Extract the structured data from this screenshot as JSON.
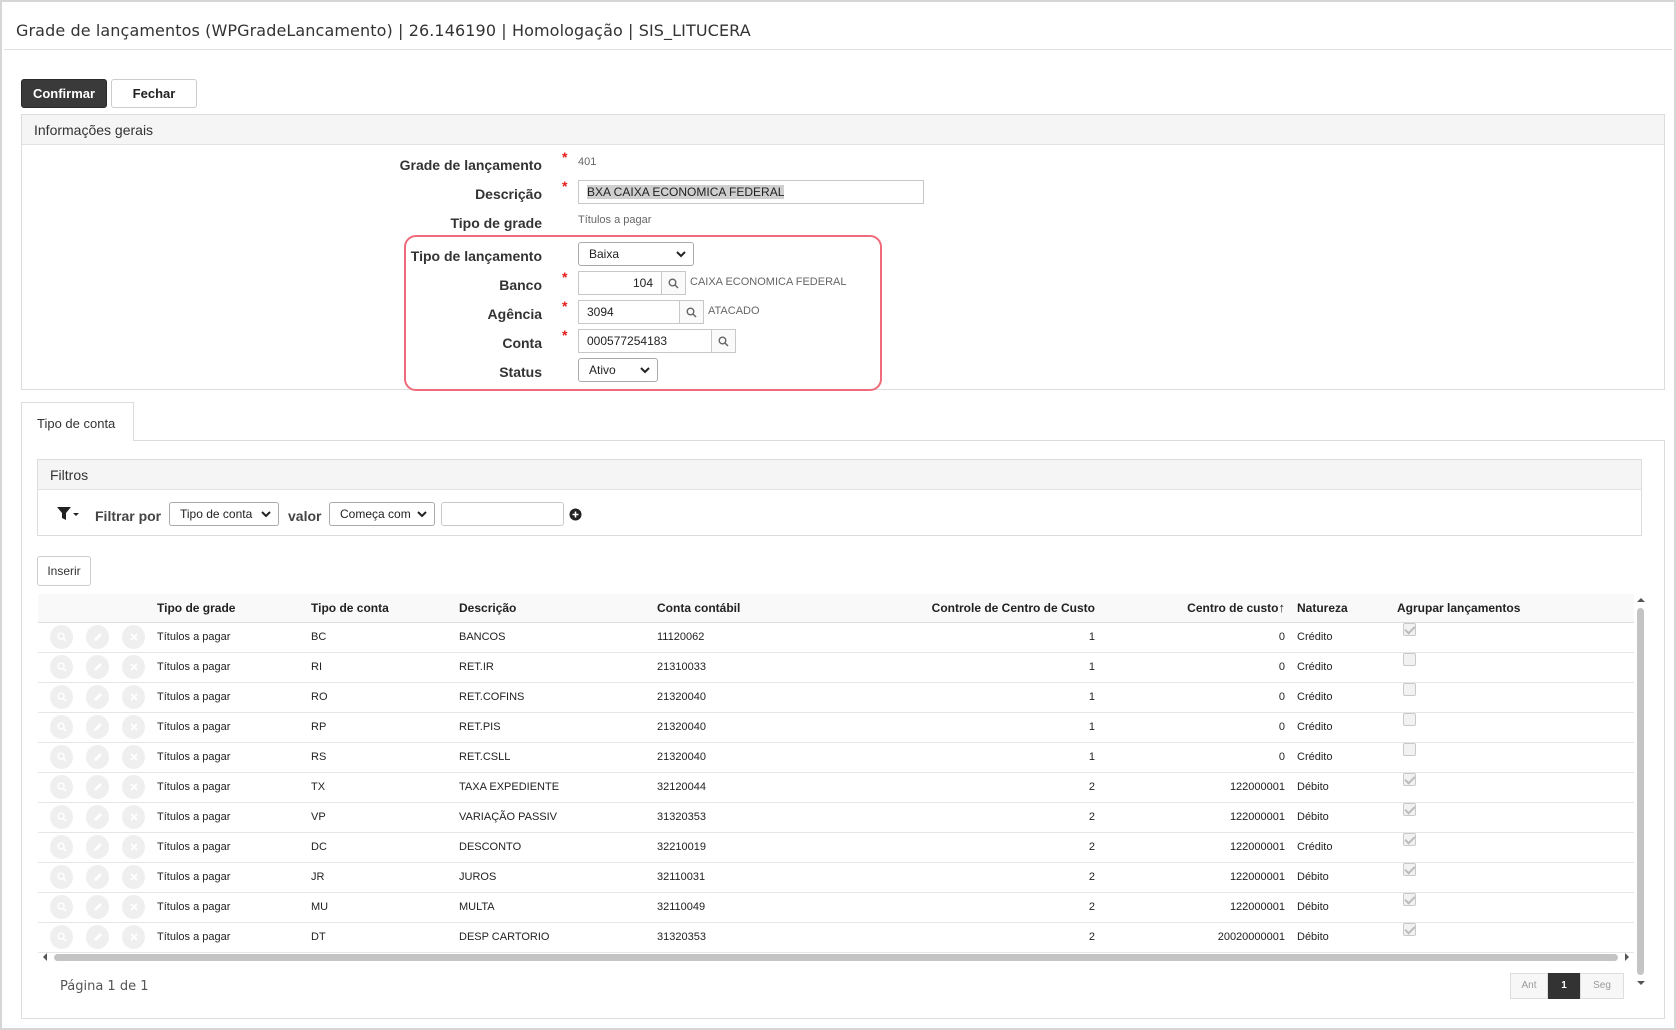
{
  "window": {
    "title": "Grade de lançamentos (WPGradeLancamento) | 26.146190 | Homologação | SIS_LITUCERA"
  },
  "toolbar": {
    "confirm_label": "Confirmar",
    "close_label": "Fechar"
  },
  "general": {
    "header": "Informações gerais",
    "fields": {
      "grade_label": "Grade de lançamento",
      "grade_value": "401",
      "descricao_label": "Descrição",
      "descricao_value": "BXA CAIXA ECONOMICA FEDERAL",
      "tipo_grade_label": "Tipo de grade",
      "tipo_grade_value": "Títulos a pagar",
      "tipo_lanc_label": "Tipo de lançamento",
      "tipo_lanc_value": "Baixa",
      "banco_label": "Banco",
      "banco_value": "104",
      "banco_desc": "CAIXA ECONOMICA FEDERAL",
      "agencia_label": "Agência",
      "agencia_value": "3094",
      "agencia_desc": "ATACADO",
      "conta_label": "Conta",
      "conta_value": "000577254183",
      "status_label": "Status",
      "status_value": "Ativo"
    },
    "required_mark": "*"
  },
  "tabs": [
    {
      "label": "Tipo de conta"
    }
  ],
  "filters": {
    "header": "Filtros",
    "filter_by_label": "Filtrar por",
    "filter_field_value": "Tipo de conta",
    "value_label": "valor",
    "operator_value": "Começa com",
    "input_value": ""
  },
  "insert_label": "Inserir",
  "table": {
    "columns": [
      "",
      "Tipo de grade",
      "Tipo de conta",
      "Descrição",
      "Conta contábil",
      "Controle de Centro de Custo",
      "Centro de custo",
      "Natureza",
      "Agrupar lançamentos"
    ],
    "sort_indicator": "↑",
    "rows": [
      {
        "tipo_grade": "Títulos a pagar",
        "tipo_conta": "BC",
        "descricao": "BANCOS",
        "conta_contabil": "11120062",
        "controle_cc": "1",
        "centro_custo": "0",
        "natureza": "Crédito",
        "agrupar": true
      },
      {
        "tipo_grade": "Títulos a pagar",
        "tipo_conta": "RI",
        "descricao": "RET.IR",
        "conta_contabil": "21310033",
        "controle_cc": "1",
        "centro_custo": "0",
        "natureza": "Crédito",
        "agrupar": false
      },
      {
        "tipo_grade": "Títulos a pagar",
        "tipo_conta": "RO",
        "descricao": "RET.COFINS",
        "conta_contabil": "21320040",
        "controle_cc": "1",
        "centro_custo": "0",
        "natureza": "Crédito",
        "agrupar": false
      },
      {
        "tipo_grade": "Títulos a pagar",
        "tipo_conta": "RP",
        "descricao": "RET.PIS",
        "conta_contabil": "21320040",
        "controle_cc": "1",
        "centro_custo": "0",
        "natureza": "Crédito",
        "agrupar": false
      },
      {
        "tipo_grade": "Títulos a pagar",
        "tipo_conta": "RS",
        "descricao": "RET.CSLL",
        "conta_contabil": "21320040",
        "controle_cc": "1",
        "centro_custo": "0",
        "natureza": "Crédito",
        "agrupar": false
      },
      {
        "tipo_grade": "Títulos a pagar",
        "tipo_conta": "TX",
        "descricao": "TAXA EXPEDIENTE",
        "conta_contabil": "32120044",
        "controle_cc": "2",
        "centro_custo": "122000001",
        "natureza": "Débito",
        "agrupar": true
      },
      {
        "tipo_grade": "Títulos a pagar",
        "tipo_conta": "VP",
        "descricao": "VARIAÇÃO PASSIV",
        "conta_contabil": "31320353",
        "controle_cc": "2",
        "centro_custo": "122000001",
        "natureza": "Débito",
        "agrupar": true
      },
      {
        "tipo_grade": "Títulos a pagar",
        "tipo_conta": "DC",
        "descricao": "DESCONTO",
        "conta_contabil": "32210019",
        "controle_cc": "2",
        "centro_custo": "122000001",
        "natureza": "Crédito",
        "agrupar": true
      },
      {
        "tipo_grade": "Títulos a pagar",
        "tipo_conta": "JR",
        "descricao": "JUROS",
        "conta_contabil": "32110031",
        "controle_cc": "2",
        "centro_custo": "122000001",
        "natureza": "Débito",
        "agrupar": true
      },
      {
        "tipo_grade": "Títulos a pagar",
        "tipo_conta": "MU",
        "descricao": "MULTA",
        "conta_contabil": "32110049",
        "controle_cc": "2",
        "centro_custo": "122000001",
        "natureza": "Débito",
        "agrupar": true
      },
      {
        "tipo_grade": "Títulos a pagar",
        "tipo_conta": "DT",
        "descricao": "DESP CARTORIO",
        "conta_contabil": "31320353",
        "controle_cc": "2",
        "centro_custo": "20020000001",
        "natureza": "Débito",
        "agrupar": true
      }
    ]
  },
  "pagination": {
    "text": "Página 1 de 1",
    "prev_label": "Ant",
    "current_page": "1",
    "next_label": "Seg"
  },
  "colors": {
    "primary_button": "#3a3a3a",
    "highlight_border": "#ef6a7a",
    "required": "#e21c1c"
  }
}
